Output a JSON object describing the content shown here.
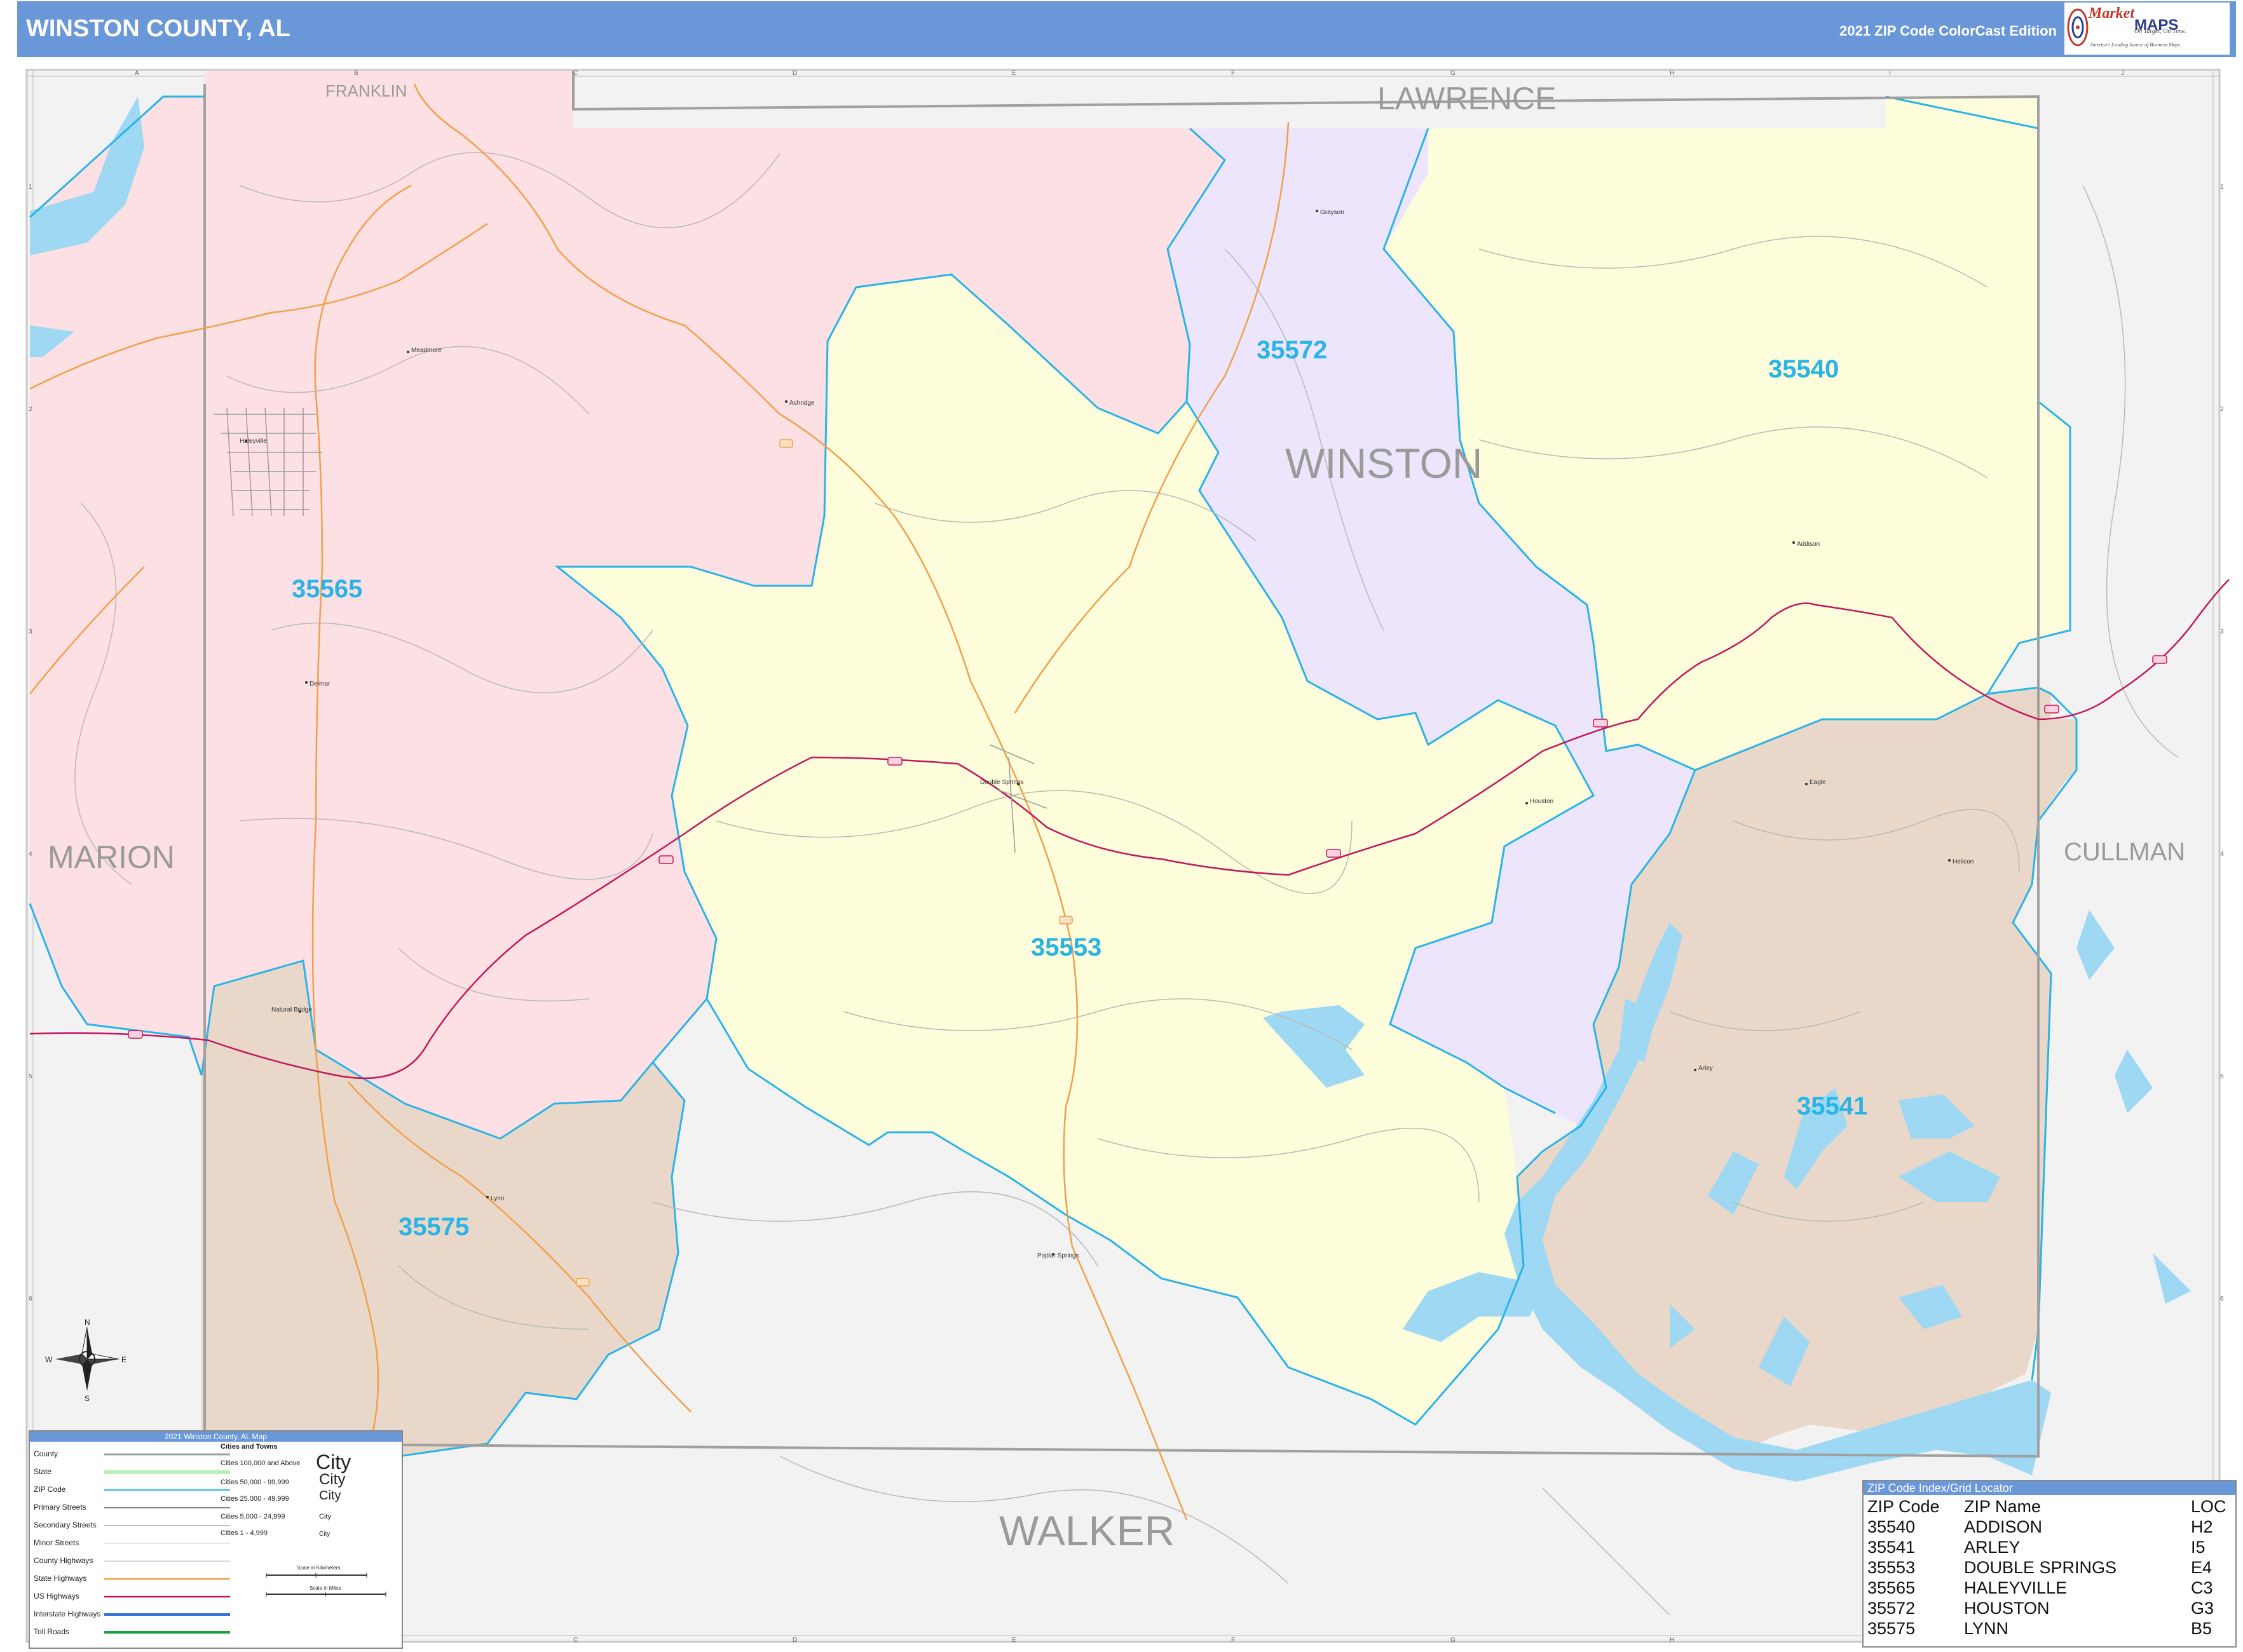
{
  "header": {
    "title": "WINSTON COUNTY, AL",
    "edition": "2021 ZIP Code ColorCast Edition",
    "logo_brand": "Market",
    "logo_maps": "MAPS",
    "logo_tagline": "America's Leading Source of Business Maps",
    "logo_slogan": "On Target, On Time."
  },
  "colors": {
    "header_bg": "#6a97d8",
    "zip_label": "#2ab4e6",
    "zip_boundary": "#2ab4e6",
    "zone_pink": "#fde0e4",
    "zone_yellow": "#fdfddc",
    "zone_purple": "#ece5fc",
    "zone_tan": "#e9d8c9",
    "water": "#9ed8f3",
    "outside": "#f2f2f2",
    "us_highway": "#c2185b",
    "state_highway": "#f0a04b"
  },
  "grid": {
    "columns": [
      "A",
      "B",
      "C",
      "D",
      "E",
      "F",
      "G",
      "H",
      "I",
      "J"
    ],
    "rows": [
      "1",
      "2",
      "3",
      "4",
      "5",
      "6",
      "7"
    ]
  },
  "counties": {
    "lawrence": "LAWRENCE",
    "franklin": "FRANKLIN",
    "marion": "MARION",
    "cullman": "CULLMAN",
    "walker": "WALKER",
    "winston": "WINSTON"
  },
  "zip_labels": {
    "z35540": "35540",
    "z35541": "35541",
    "z35553": "35553",
    "z35565": "35565",
    "z35572": "35572",
    "z35575": "35575"
  },
  "places": {
    "grayson": "Grayson",
    "addison": "Addison",
    "haleyville": "Haleyville",
    "meadmore": "Meadmore",
    "ashridge": "Ashridge",
    "delmar": "Delmar",
    "double_springs": "Double Springs",
    "houston": "Houston",
    "eagle": "Eagle",
    "helicon": "Helicon",
    "arley": "Arley",
    "natural_bridge": "Natural Bridge",
    "lynn": "Lynn",
    "poplar_springs": "Poplar Springs"
  },
  "compass": {
    "n": "N",
    "s": "S",
    "e": "E",
    "w": "W"
  },
  "legend": {
    "title": "2021 Winston County, AL Map",
    "items": [
      "County",
      "State",
      "ZIP Code",
      "Primary Streets",
      "Secondary Streets",
      "Minor Streets",
      "County Highways",
      "State Highways",
      "US Highways",
      "Interstate Highways",
      "Toll Roads"
    ],
    "cities_heading": "Cities and Towns",
    "city_tiers": [
      "Cities 100,000 and Above",
      "Cities 50,000 - 99,999",
      "Cities 25,000 - 49,999",
      "Cities 5,000 - 24,999",
      "Cities 1 - 4,999"
    ],
    "city_samples": [
      "City",
      "City",
      "City",
      "City",
      "City"
    ],
    "scale_km": "Scale in Kilometers",
    "scale_mi": "Scale in Miles"
  },
  "zip_index": {
    "title": "ZIP Code Index/Grid Locator",
    "headers": [
      "ZIP Code",
      "ZIP Name",
      "LOC"
    ],
    "rows": [
      [
        "35540",
        "ADDISON",
        "H2"
      ],
      [
        "35541",
        "ARLEY",
        "I5"
      ],
      [
        "35553",
        "DOUBLE SPRINGS",
        "E4"
      ],
      [
        "35565",
        "HALEYVILLE",
        "C3"
      ],
      [
        "35572",
        "HOUSTON",
        "G3"
      ],
      [
        "35575",
        "LYNN",
        "B5"
      ]
    ]
  }
}
